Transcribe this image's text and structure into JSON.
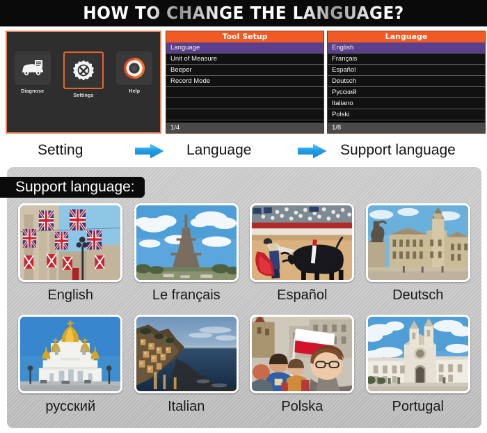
{
  "header": {
    "title": "HOW TO CHANGE THE LANGUAGE?",
    "background_color": "#0a0a0a",
    "text_color": "#ffffff"
  },
  "steps": {
    "device": {
      "name": "device-home-screen",
      "selected_item": "Settings",
      "highlight_color": "#e2682a",
      "items": [
        {
          "label": "Diagnose",
          "icon": "car-clipboard-icon",
          "selected": false
        },
        {
          "label": "Settings",
          "icon": "gear-tools-icon",
          "selected": true
        },
        {
          "label": "Help",
          "icon": "life-ring-icon",
          "selected": false
        }
      ]
    },
    "tool_setup": {
      "title": "Tool Setup",
      "header_color": "#f15a22",
      "selected_color": "#5b3f8c",
      "rows": [
        {
          "label": "Language",
          "selected": true
        },
        {
          "label": "Unit of Measure",
          "selected": false
        },
        {
          "label": "Beeper",
          "selected": false
        },
        {
          "label": "Record Mode",
          "selected": false
        },
        {
          "label": "",
          "selected": false
        },
        {
          "label": "",
          "selected": false
        },
        {
          "label": "",
          "selected": false
        }
      ],
      "footer": "1/4"
    },
    "language": {
      "title": "Language",
      "header_color": "#f15a22",
      "selected_color": "#5b3f8c",
      "rows": [
        {
          "label": "English",
          "selected": true
        },
        {
          "label": "Français",
          "selected": false
        },
        {
          "label": "Español",
          "selected": false
        },
        {
          "label": "Deutsch",
          "selected": false
        },
        {
          "label": "Русский",
          "selected": false
        },
        {
          "label": "Italiano",
          "selected": false
        },
        {
          "label": "Polski",
          "selected": false
        }
      ],
      "footer": "1/8"
    }
  },
  "captions": {
    "setting": "Setting",
    "language": "Language",
    "support": "Support language",
    "arrow_icon": "arrow-right-icon",
    "arrow_color": "#1e9ee8"
  },
  "support_section": {
    "title": "Support language:",
    "panel_color": "#c3c3c3",
    "languages": [
      {
        "label": "English",
        "image": "union-jack-flags-london-street"
      },
      {
        "label": "Le français",
        "image": "eiffel-tower-paris"
      },
      {
        "label": "Español",
        "image": "matador-bullfight-arena"
      },
      {
        "label": "Deutsch",
        "image": "dresden-castle-square"
      },
      {
        "label": "русский",
        "image": "moscow-cathedral-golden-domes"
      },
      {
        "label": "Italian",
        "image": "cinque-terre-coast-dusk"
      },
      {
        "label": "Polska",
        "image": "crowd-with-polish-flag"
      },
      {
        "label": "Portugal",
        "image": "alcobaca-monastery-facade"
      }
    ]
  }
}
